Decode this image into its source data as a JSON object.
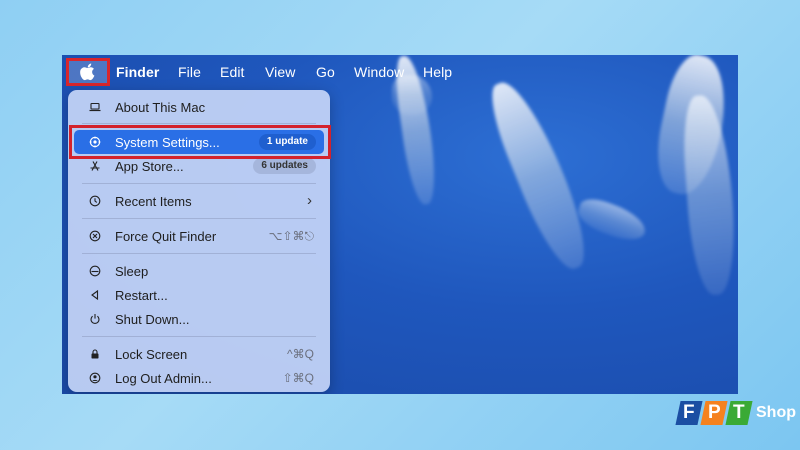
{
  "menubar": {
    "app_name": "Finder",
    "menus": [
      "File",
      "Edit",
      "View",
      "Go",
      "Window",
      "Help"
    ]
  },
  "apple_menu": {
    "items": [
      {
        "label": "About This Mac",
        "icon": "laptop-icon"
      },
      {
        "label": "System Settings...",
        "icon": "settings-icon",
        "badge": "1 update",
        "selected": true
      },
      {
        "label": "App Store...",
        "icon": "app-store-icon",
        "badge": "6 updates"
      },
      {
        "label": "Recent Items",
        "icon": "clock-icon",
        "submenu": true
      },
      {
        "label": "Force Quit Finder",
        "icon": "force-quit-icon",
        "shortcut": "⌥⇧⌘⎋"
      },
      {
        "label": "Sleep",
        "icon": "sleep-icon"
      },
      {
        "label": "Restart...",
        "icon": "restart-icon"
      },
      {
        "label": "Shut Down...",
        "icon": "power-icon"
      },
      {
        "label": "Lock Screen",
        "icon": "lock-icon",
        "shortcut": "^⌘Q"
      },
      {
        "label": "Log Out Admin...",
        "icon": "user-icon",
        "shortcut": "⇧⌘Q"
      }
    ]
  },
  "branding": {
    "letters": [
      "F",
      "P",
      "T"
    ],
    "suffix": "Shop"
  },
  "colors": {
    "highlight": "#d3222c",
    "selection": "#2a6fe6",
    "desktop": "#1f57bd",
    "brand_blue": "#1b4ea3",
    "brand_orange": "#f5821f",
    "brand_green": "#3aaa35"
  }
}
